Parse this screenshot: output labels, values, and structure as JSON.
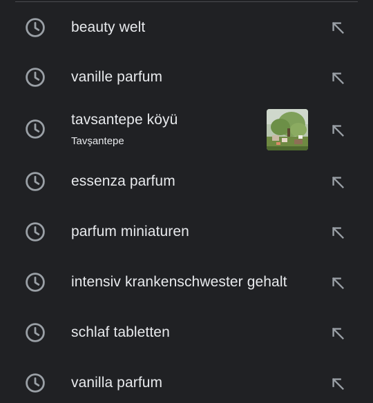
{
  "history": {
    "items": [
      {
        "label": "beauty welt",
        "sublabel": "",
        "icon": "history-clock-icon",
        "action_icon": "fill-query-arrow-icon"
      },
      {
        "label": "vanille parfum",
        "sublabel": "",
        "icon": "history-clock-icon",
        "action_icon": "fill-query-arrow-icon"
      },
      {
        "label": "tavsantepe köyü",
        "sublabel": "Tavşantepe",
        "icon": "history-clock-icon",
        "action_icon": "fill-query-arrow-icon",
        "thumbnail": "village-trees-photo"
      },
      {
        "label": "essenza parfum",
        "sublabel": "",
        "icon": "history-clock-icon",
        "action_icon": "fill-query-arrow-icon"
      },
      {
        "label": "parfum miniaturen",
        "sublabel": "",
        "icon": "history-clock-icon",
        "action_icon": "fill-query-arrow-icon"
      },
      {
        "label": "intensiv krankenschwester gehalt",
        "sublabel": "",
        "icon": "history-clock-icon",
        "action_icon": "fill-query-arrow-icon"
      },
      {
        "label": "schlaf tabletten",
        "sublabel": "",
        "icon": "history-clock-icon",
        "action_icon": "fill-query-arrow-icon"
      },
      {
        "label": "vanilla parfum",
        "sublabel": "",
        "icon": "history-clock-icon",
        "action_icon": "fill-query-arrow-icon"
      }
    ]
  },
  "colors": {
    "background": "#202124",
    "text": "#e8eaed",
    "icon": "#9aa0a6"
  }
}
